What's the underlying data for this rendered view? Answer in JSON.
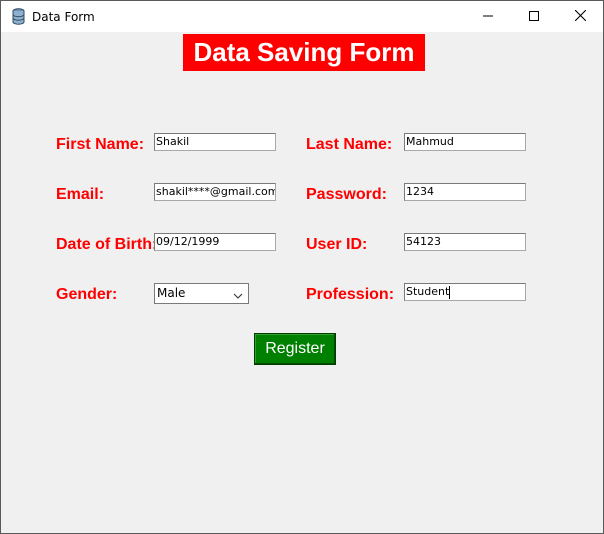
{
  "window": {
    "title": "Data Form",
    "icon": "database-icon",
    "controls": [
      "minimize-icon",
      "maximize-icon",
      "close-icon"
    ]
  },
  "form": {
    "heading": "Data Saving Form",
    "fields": {
      "first_name": {
        "label": "First Name:",
        "value": "Shakil"
      },
      "last_name": {
        "label": "Last Name:",
        "value": "Mahmud"
      },
      "email": {
        "label": "Email:",
        "value": "shakil****@gmail.com"
      },
      "password": {
        "label": "Password:",
        "value": "1234"
      },
      "dob": {
        "label": "Date of Birth:",
        "value": "09/12/1999"
      },
      "user_id": {
        "label": "User ID:",
        "value": "54123"
      },
      "gender": {
        "label": "Gender:",
        "value": "Male"
      },
      "profession": {
        "label": "Profession:",
        "value": "Student"
      }
    },
    "register_label": "Register"
  },
  "colors": {
    "label": "#ff0000",
    "heading_bg": "#ff0000",
    "button_bg": "#008000",
    "window_bg": "#f0f0f0"
  }
}
